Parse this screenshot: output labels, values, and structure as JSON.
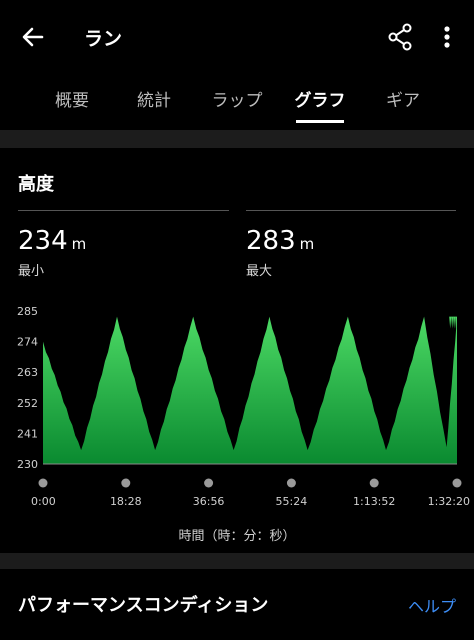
{
  "header": {
    "title": "ラン"
  },
  "tabs": [
    {
      "label": "概要",
      "active": false
    },
    {
      "label": "統計",
      "active": false
    },
    {
      "label": "ラップ",
      "active": false
    },
    {
      "label": "グラフ",
      "active": true
    },
    {
      "label": "ギア",
      "active": false
    }
  ],
  "section": {
    "title": "高度",
    "min": {
      "value": "234",
      "unit": "m",
      "label": "最小"
    },
    "max": {
      "value": "283",
      "unit": "m",
      "label": "最大"
    }
  },
  "chart_data": {
    "type": "area",
    "ylim": [
      230,
      285
    ],
    "y_ticks": [
      "285",
      "274",
      "263",
      "252",
      "241",
      "230"
    ],
    "x_ticks": [
      "0:00",
      "18:28",
      "36:56",
      "55:24",
      "1:13:52",
      "1:32:20"
    ],
    "xlabel": "時間（時：分：秒）",
    "color": "#1db954",
    "series": [
      {
        "x": [
          0.0,
          8.5,
          16.5,
          25.0,
          33.5,
          42.5,
          50.5,
          59.0,
          68.0,
          76.5,
          85.0,
          90.0,
          92.33
        ],
        "y": [
          274,
          235,
          283,
          235,
          283,
          235,
          283,
          235,
          283,
          235,
          283,
          236,
          283
        ]
      }
    ]
  },
  "perf": {
    "title": "パフォーマンスコンディション",
    "help": "ヘルプ"
  },
  "colors": {
    "accent": "#3d8df5",
    "chart_fill_top": "#4cd964",
    "chart_fill_bottom": "#0a8a30"
  }
}
